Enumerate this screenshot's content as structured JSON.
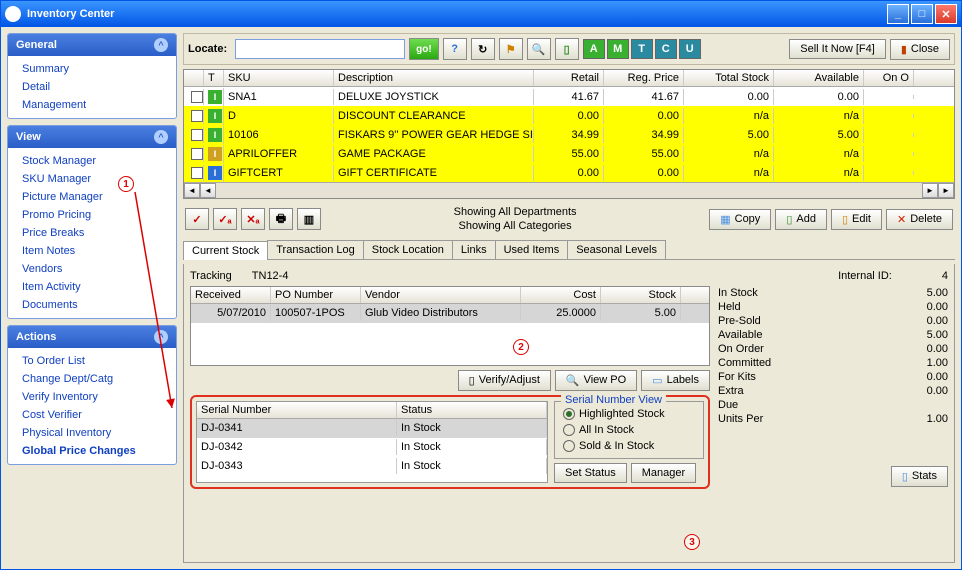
{
  "window": {
    "title": "Inventory Center",
    "sell_it": "Sell It Now [F4]",
    "close": "Close"
  },
  "locate": {
    "label": "Locate:",
    "go": "go!"
  },
  "letter_btns": [
    "A",
    "M",
    "T",
    "C",
    "U"
  ],
  "sidebar": {
    "general": {
      "title": "General",
      "items": [
        "Summary",
        "Detail",
        "Management"
      ]
    },
    "view": {
      "title": "View",
      "items": [
        "Stock Manager",
        "SKU Manager",
        "Picture Manager",
        "Promo Pricing",
        "Price Breaks",
        "Item Notes",
        "Vendors",
        "Item Activity",
        "Documents"
      ]
    },
    "actions": {
      "title": "Actions",
      "items": [
        "To Order List",
        "Change Dept/Catg",
        "Verify Inventory",
        "Cost Verifier",
        "Physical Inventory",
        "Global Price Changes"
      ]
    }
  },
  "grid": {
    "headers": {
      "t": "T",
      "sku": "SKU",
      "desc": "Description",
      "retail": "Retail",
      "reg": "Reg. Price",
      "total": "Total Stock",
      "avail": "Available",
      "onord": "On O"
    },
    "rows": [
      {
        "ticon": "g",
        "sku": "SNA1",
        "desc": "DELUXE JOYSTICK",
        "retail": "41.67",
        "reg": "41.67",
        "total": "0.00",
        "avail": "0.00",
        "yellow": false
      },
      {
        "ticon": "g",
        "sku": "D",
        "desc": "DISCOUNT CLEARANCE",
        "retail": "0.00",
        "reg": "0.00",
        "total": "n/a",
        "avail": "n/a",
        "yellow": true
      },
      {
        "ticon": "g",
        "sku": "10106",
        "desc": "FISKARS 9'' POWER GEAR HEDGE SI",
        "retail": "34.99",
        "reg": "34.99",
        "total": "5.00",
        "avail": "5.00",
        "yellow": true
      },
      {
        "ticon": "t",
        "sku": "APRILOFFER",
        "desc": "GAME PACKAGE",
        "retail": "55.00",
        "reg": "55.00",
        "total": "n/a",
        "avail": "n/a",
        "yellow": true
      },
      {
        "ticon": "b",
        "sku": "GIFTCERT",
        "desc": "GIFT CERTIFICATE",
        "retail": "0.00",
        "reg": "0.00",
        "total": "n/a",
        "avail": "n/a",
        "yellow": true
      }
    ]
  },
  "showing": {
    "l1": "Showing All Departments",
    "l2": "Showing All Categories"
  },
  "actions_btns": {
    "copy": "Copy",
    "add": "Add",
    "edit": "Edit",
    "delete": "Delete"
  },
  "tabs": [
    "Current Stock",
    "Transaction Log",
    "Stock Location",
    "Links",
    "Used Items",
    "Seasonal Levels"
  ],
  "tracking": {
    "label": "Tracking",
    "value": "TN12-4",
    "internal_id_lbl": "Internal ID:",
    "internal_id": "4"
  },
  "po_grid": {
    "headers": {
      "received": "Received",
      "po": "PO Number",
      "vendor": "Vendor",
      "cost": "Cost",
      "stock": "Stock"
    },
    "row": {
      "received": "5/07/2010",
      "po": "100507-1POS",
      "vendor": "Glub Video Distributors",
      "cost": "25.0000",
      "stock": "5.00"
    }
  },
  "stock_btns": {
    "verify": "Verify/Adjust",
    "viewpo": "View PO",
    "labels": "Labels"
  },
  "info": [
    {
      "k": "In Stock",
      "v": "5.00"
    },
    {
      "k": "Held",
      "v": "0.00"
    },
    {
      "k": "Pre-Sold",
      "v": "0.00"
    },
    {
      "k": "Available",
      "v": "5.00"
    },
    {
      "k": "On Order",
      "v": "0.00"
    },
    {
      "k": "Committed",
      "v": "1.00"
    },
    {
      "k": "For Kits",
      "v": "0.00"
    },
    {
      "k": "Extra",
      "v": "0.00"
    },
    {
      "k": "Due",
      "v": ""
    },
    {
      "k": "Units Per",
      "v": "1.00"
    }
  ],
  "serial": {
    "headers": {
      "sn": "Serial Number",
      "status": "Status"
    },
    "rows": [
      {
        "sn": "DJ-0341",
        "st": "In Stock",
        "sel": true
      },
      {
        "sn": "DJ-0342",
        "st": "In Stock",
        "sel": false
      },
      {
        "sn": "DJ-0343",
        "st": "In Stock",
        "sel": false
      }
    ]
  },
  "snv": {
    "title": "Serial Number View",
    "opts": [
      "Highlighted Stock",
      "All In Stock",
      "Sold & In Stock"
    ],
    "set": "Set Status",
    "mgr": "Manager"
  },
  "stats": "Stats",
  "annot": {
    "a1": "1",
    "a2": "2",
    "a3": "3"
  }
}
